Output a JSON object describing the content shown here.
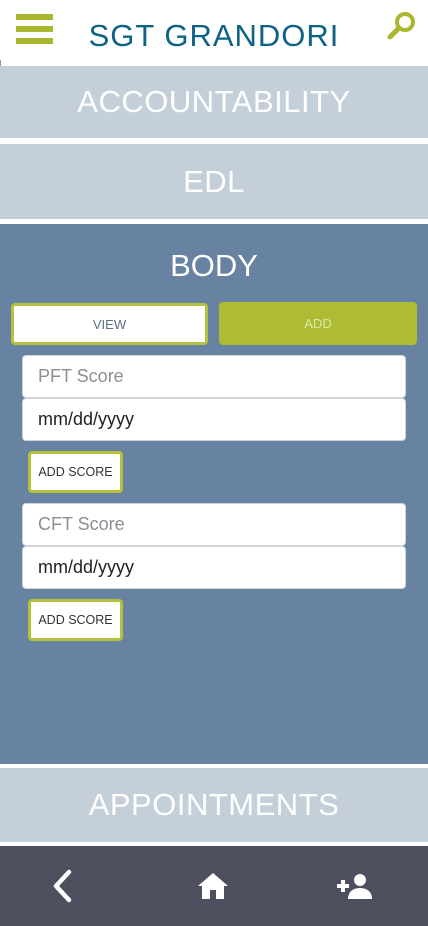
{
  "header": {
    "title": "SGT GRANDORI",
    "menu_icon": "hamburger-menu-icon",
    "search_icon": "search-icon",
    "accent_color": "#a9b82f",
    "title_color": "#0e6384"
  },
  "sections": {
    "accountability": "ACCOUNTABILITY",
    "edl": "EDL",
    "body": "BODY",
    "appointments": "APPOINTMENTS"
  },
  "body_panel": {
    "view_label": "VIEW",
    "add_label": "ADD",
    "pft": {
      "placeholder": "PFT Score",
      "value": "",
      "date": "mm/dd/yyyy"
    },
    "cft": {
      "placeholder": "CFT Score",
      "value": "",
      "date": "mm/dd/yyyy"
    },
    "add_score_label": "ADD SCORE",
    "panel_color": "#6883a1"
  },
  "bottom_nav": {
    "icons": [
      "back-icon",
      "home-icon",
      "add-person-icon"
    ],
    "bar_color": "#4d4e5e"
  }
}
